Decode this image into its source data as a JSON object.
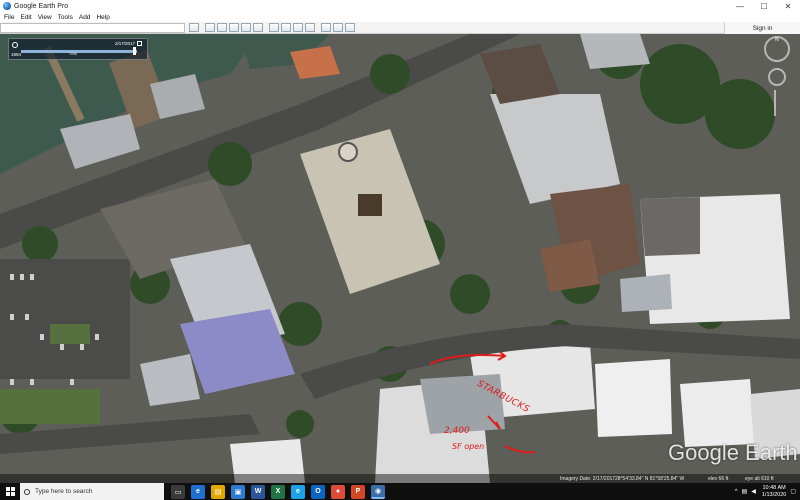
{
  "window": {
    "title": "Google Earth Pro",
    "controls": [
      "—",
      "☐",
      "✕"
    ]
  },
  "menu": [
    "File",
    "Edit",
    "View",
    "Tools",
    "Add",
    "Help"
  ],
  "toolbar": {
    "signin_label": "Sign in"
  },
  "time_slider": {
    "start_year": "1994",
    "current_date": "2/17/2017",
    "mid_label": "7/94"
  },
  "annotations": {
    "starbucks": "STARBUCKS",
    "space": "2,400",
    "sqft": "SF open"
  },
  "logo": "Google Earth",
  "status": {
    "imagery_date": "Imagery Date: 2/17/2017",
    "coords": "28°54'33.84\" N   81°58'25.84\" W",
    "elev": "elev  66 ft",
    "eye_alt": "eye alt  610 ft"
  },
  "taskbar": {
    "search_placeholder": "Type here to search",
    "time": "10:48 AM",
    "date": "1/13/2020",
    "app_icons": [
      {
        "name": "task-view-icon",
        "glyph": "▭",
        "color": "#3a3a3a"
      },
      {
        "name": "edge-icon",
        "glyph": "e",
        "color": "#1f6fd1"
      },
      {
        "name": "file-explorer-icon",
        "glyph": "▤",
        "color": "#e0a800"
      },
      {
        "name": "store-icon",
        "glyph": "▣",
        "color": "#2b7bd1"
      },
      {
        "name": "word-icon",
        "glyph": "W",
        "color": "#2b579a"
      },
      {
        "name": "excel-icon",
        "glyph": "X",
        "color": "#217346"
      },
      {
        "name": "ie-icon",
        "glyph": "e",
        "color": "#1ea1e8"
      },
      {
        "name": "outlook-icon",
        "glyph": "O",
        "color": "#0a64c1"
      },
      {
        "name": "chrome-icon",
        "glyph": "●",
        "color": "#dd4b39"
      },
      {
        "name": "powerpoint-icon",
        "glyph": "P",
        "color": "#d24726"
      },
      {
        "name": "google-earth-icon",
        "glyph": "◉",
        "color": "#3b6ea8"
      }
    ]
  }
}
